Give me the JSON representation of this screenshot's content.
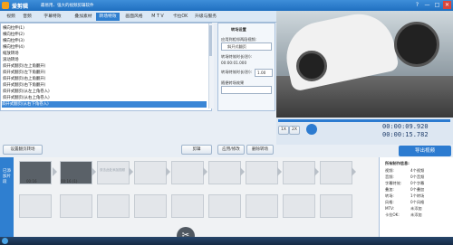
{
  "app": {
    "name": "爱剪辑",
    "slogan": "最易用、强大的视频剪辑软件"
  },
  "window_buttons": [
    "?",
    "—",
    "□",
    "✕"
  ],
  "tabs": [
    "视频",
    "音频",
    "字幕特效",
    "叠加素材",
    "转场特效",
    "画面风格",
    "M T V",
    "卡拉OK",
    "升级与服务"
  ],
  "active_tab_index": 4,
  "transitions": [
    "横向拉伸(1)",
    "横向拉伸(2)",
    "横向拉伸(3)",
    "横向拉伸(4)",
    "缩放转场",
    "滚动转场",
    "斜开式翻页(左上角翻开)",
    "斜开式翻页(左下角翻开)",
    "斜开式翻页(右上角翻开)",
    "斜开式翻页(右下角翻开)",
    "斜开式翻页(从左上角卷入)",
    "斜开式翻页(从右上角卷入)",
    "斜开式翻页(从左下角卷入)",
    "斜开式翻页(从右下角卷入)",
    "平移式翻页(从右往左)",
    "平移式翻页(从左往右)",
    "平移式翻页(从下往上)",
    "平移式翻页(从上往下)",
    "平移式翻页(左下角翻开)",
    "平移式翻页(右上角翻开)"
  ],
  "selected_transition_index": 13,
  "left_buttons": {
    "apply": "应用/修改",
    "delete": "删除转场",
    "add_wipe": "设置翻页转场",
    "cut": "剪辑"
  },
  "options": {
    "group_title": "转场设置",
    "effect_label": "应用到相邻两段视频:",
    "effect_value": "斜开式翻页",
    "duration_label": "转场特效时长(秒):",
    "duration_value": "00:00:01.000",
    "speed_label": "转场特效时长(秒):",
    "speed_value": "1.00",
    "apply_label": "随便转场效果",
    "apply_all_label": "应用到所有转场"
  },
  "player": {
    "current_time": "00:00:09.920",
    "total_time": "00:00:15.782",
    "speed": "1X",
    "volume": "2X"
  },
  "export_label": "导出视频",
  "timeline": {
    "side_label": "已添加片段",
    "clips": [
      {
        "label": "00:16"
      },
      {
        "label": "00:16 (1)"
      }
    ],
    "placeholder": "双击此处添加视频"
  },
  "info": {
    "title": "所有制作信息:",
    "rows": [
      {
        "key": "视频:",
        "value": "4个视频"
      },
      {
        "key": "音频:",
        "value": "0个音频"
      },
      {
        "key": "字幕特效:",
        "value": "0个字幕"
      },
      {
        "key": "叠加:",
        "value": "0个叠加"
      },
      {
        "key": "转场:",
        "value": "1个转场"
      },
      {
        "key": "风格:",
        "value": "0个风格"
      },
      {
        "key": "MTV:",
        "value": "未添加"
      },
      {
        "key": "卡拉OK:",
        "value": "未添加"
      }
    ]
  },
  "colors": {
    "accent": "#2f7fd0",
    "selected": "#3a86d6"
  }
}
